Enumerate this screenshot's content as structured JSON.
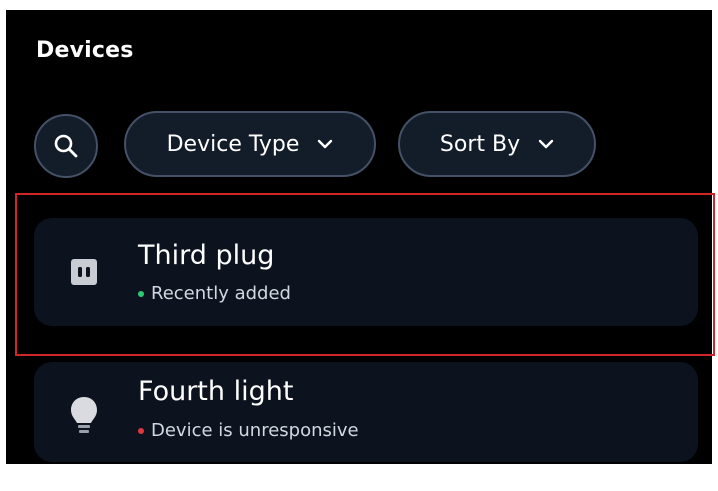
{
  "header": {
    "title": "Devices"
  },
  "filters": {
    "search_icon": "search-icon",
    "device_type_label": "Device Type",
    "sort_by_label": "Sort By"
  },
  "devices": [
    {
      "name": "Third plug",
      "status": "Recently added",
      "status_color": "#2ecc71",
      "icon": "plug-icon"
    },
    {
      "name": "Fourth light",
      "status": "Device is unresponsive",
      "status_color": "#e0383e",
      "icon": "lightbulb-icon"
    }
  ],
  "colors": {
    "background": "#000000",
    "card": "#0c131e",
    "pill": "#131c29",
    "pill_border": "#455166",
    "highlight": "#d0262a"
  }
}
